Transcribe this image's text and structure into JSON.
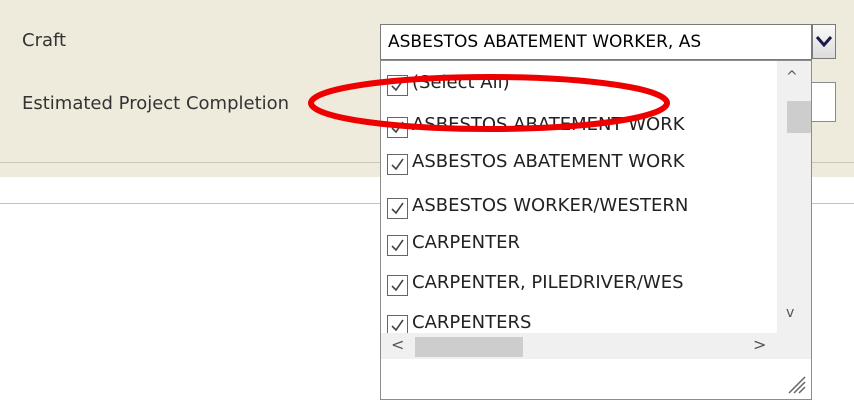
{
  "form": {
    "craft_label": "Craft",
    "completion_label": "Estimated Project Completion"
  },
  "craft_select": {
    "value": "ASBESTOS ABATEMENT WORKER, AS",
    "toggle_icon": "chevron-down-icon"
  },
  "dropdown": {
    "options": [
      {
        "label": "(Select All)",
        "checked": true
      },
      {
        "label": "ASBESTOS ABATEMENT WORK",
        "checked": true
      },
      {
        "label": "ASBESTOS ABATEMENT WORK",
        "checked": true
      },
      {
        "label": "ASBESTOS WORKER/WESTERN",
        "checked": true
      },
      {
        "label": "CARPENTER",
        "checked": true
      },
      {
        "label": "CARPENTER, PILEDRIVER/WES",
        "checked": true
      },
      {
        "label": "CARPENTERS",
        "checked": true
      }
    ],
    "scrollbar": {
      "up": "^",
      "down": "v",
      "left": "<",
      "right": ">"
    }
  },
  "annotation": {
    "color": "#ee0000"
  }
}
